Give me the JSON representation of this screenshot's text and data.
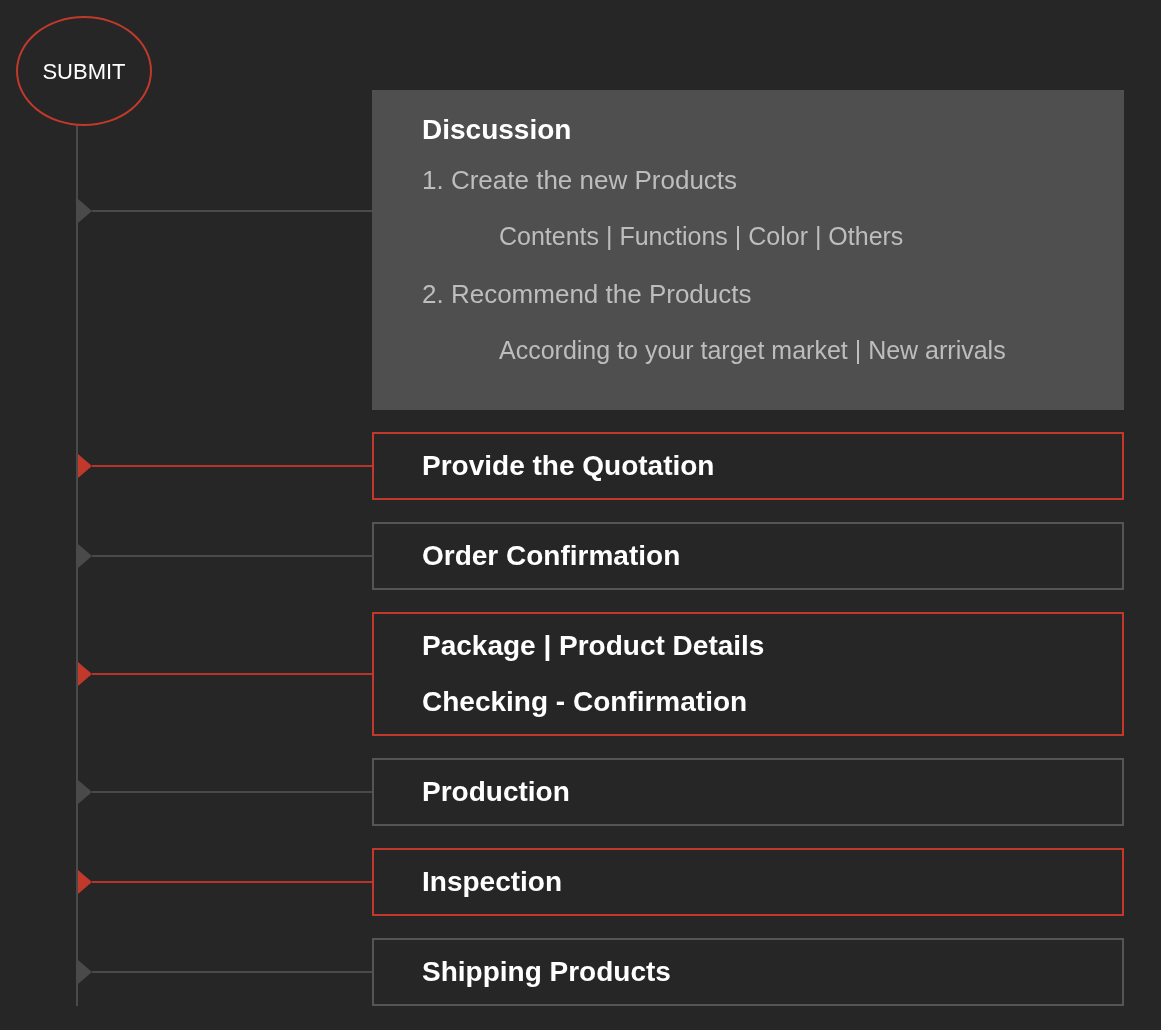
{
  "submit_button": "SUBMIT",
  "steps": [
    {
      "kind": "expanded",
      "highlighted": false,
      "title": "Discussion",
      "items": [
        {
          "text": "1. Create the new Products",
          "children": [
            {
              "text": "Contents | Functions | Color | Others"
            }
          ]
        },
        {
          "text": "2. Recommend the Products",
          "children": [
            {
              "text": "According to your target market | New arrivals"
            }
          ]
        }
      ]
    },
    {
      "kind": "plain",
      "highlighted": true,
      "lines": [
        "Provide the Quotation"
      ]
    },
    {
      "kind": "plain",
      "highlighted": false,
      "lines": [
        "Order Confirmation"
      ]
    },
    {
      "kind": "plain",
      "highlighted": true,
      "lines": [
        "Package | Product Details",
        "Checking - Confirmation"
      ]
    },
    {
      "kind": "plain",
      "highlighted": false,
      "lines": [
        "Production"
      ]
    },
    {
      "kind": "plain",
      "highlighted": true,
      "lines": [
        "Inspection"
      ]
    },
    {
      "kind": "plain",
      "highlighted": false,
      "lines": [
        "Shipping Products"
      ]
    }
  ]
}
